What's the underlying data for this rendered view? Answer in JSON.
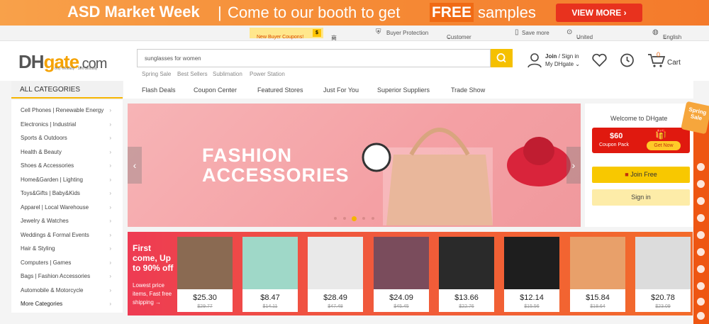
{
  "banner": {
    "title": "ASD Market Week",
    "sep": "|",
    "text1": "Come to our booth to get",
    "free": "FREE",
    "text2": "samples",
    "cta": "VIEW MORE"
  },
  "topbar": {
    "new_buyer": "New Buyer Coupons!",
    "coin": "$",
    "merchant": "商户首页",
    "buyer_protection": "Buyer Protection",
    "customer_service": "Customer Service",
    "save_more": "Save more",
    "region": "United States / USD",
    "language": "English"
  },
  "header": {
    "logo_main": "DH",
    "logo_accent": "gate",
    "logo_tail": ".com",
    "logo_sub": "Buy Globally · Sell Globally",
    "search_value": "sunglasses for women",
    "hot_searches": [
      "Spring Sale",
      "Best Sellers",
      "Sublimation",
      "Power Station"
    ],
    "join": "Join",
    "sep": "/",
    "signin": "Sign in",
    "my": "My DHgate",
    "cart_count": "0",
    "cart": "Cart"
  },
  "categories": {
    "head": "ALL CATEGORIES",
    "items": [
      "Cell Phones  |  Renewable Energy",
      "Electronics  |  Industrial",
      "Sports & Outdoors",
      "Health & Beauty",
      "Shoes & Accessories",
      "Home&Garden  |  Lighting",
      "Toys&Gifts  |  Baby&Kids",
      "Apparel  |  Local Warehouse",
      "Jewelry & Watches",
      "Weddings & Formal Events",
      "Hair & Styling",
      "Computers  |  Games",
      "Bags  |  Fashion Accessories",
      "Automobile & Motorcycle",
      "More Categories"
    ]
  },
  "nav": [
    "Flash Deals",
    "Coupon Center",
    "Featured Stores",
    "Just For You",
    "Superior Suppliers",
    "Trade Show"
  ],
  "hero": {
    "line1": "FASHION",
    "line2": "ACCESSORIES"
  },
  "welcome": {
    "title": "Welcome to DHgate",
    "amount": "$60",
    "pack": "Coupon Pack",
    "get": "Get Now",
    "join_free": "Join Free",
    "sign_in": "Sign in"
  },
  "side": {
    "badge": "Spring Sale"
  },
  "flash": {
    "title": "First come, Up to 90% off",
    "sub": "Lowest price items,  Fast free shipping →"
  },
  "products": [
    {
      "price": "$25.30",
      "old": "$29.77",
      "color": "#8a6a52"
    },
    {
      "price": "$8.47",
      "old": "$14.11",
      "color": "#9fd8c8"
    },
    {
      "price": "$28.49",
      "old": "$47.48",
      "color": "#e9e9e9"
    },
    {
      "price": "$24.09",
      "old": "$45.45",
      "color": "#7a4c5c"
    },
    {
      "price": "$13.66",
      "old": "$22.76",
      "color": "#2a2a2a"
    },
    {
      "price": "$12.14",
      "old": "$15.56",
      "color": "#1e1e1e"
    },
    {
      "price": "$15.84",
      "old": "$18.64",
      "color": "#e8a06a"
    },
    {
      "price": "$20.78",
      "old": "$23.09",
      "color": "#dcdcdc"
    }
  ]
}
